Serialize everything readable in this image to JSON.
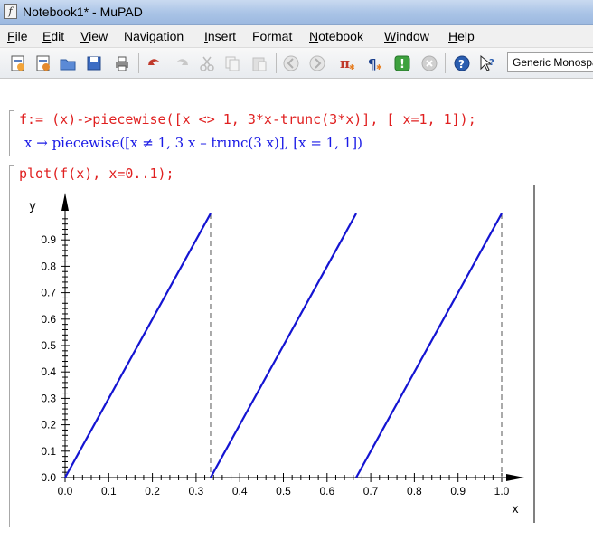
{
  "window": {
    "title": "Notebook1* - MuPAD",
    "icon": "mupad-app-icon"
  },
  "menubar": {
    "items": [
      {
        "label": "File",
        "u": "F",
        "rest": "ile"
      },
      {
        "label": "Edit",
        "u": "E",
        "rest": "dit"
      },
      {
        "label": "View",
        "u": "V",
        "rest": "iew"
      },
      {
        "label": "Navigation",
        "u": "",
        "rest": "Navigation"
      },
      {
        "label": "Insert",
        "u": "I",
        "rest": "nsert"
      },
      {
        "label": "Format",
        "u": "",
        "rest": "Format"
      },
      {
        "label": "Notebook",
        "u": "N",
        "rest": "otebook"
      },
      {
        "label": "Window",
        "u": "W",
        "rest": "indow"
      },
      {
        "label": "Help",
        "u": "H",
        "rest": "elp"
      }
    ]
  },
  "toolbar": {
    "icons": [
      "new-notebook-icon",
      "open-notebook-icon",
      "open-folder-icon",
      "save-icon",
      "print-icon",
      "undo-icon",
      "redo-icon",
      "cut-icon",
      "copy-icon",
      "paste-icon",
      "back-icon",
      "forward-icon",
      "pi-evaluate-icon",
      "formatting-icon",
      "evaluate-icon",
      "stop-icon",
      "help-icon",
      "context-help-icon"
    ],
    "font_selector": "Generic Monospace"
  },
  "notebook": {
    "input1": "f:= (x)->piecewise([x <> 1, 3*x-trunc(3*x)], [ x=1, 1]);",
    "output1": "x → piecewise([x ≠ 1, 3 x – trunc(3 x)], [x = 1, 1])",
    "input2": "plot(f(x), x=0..1);"
  },
  "chart_data": {
    "type": "line",
    "title": "",
    "xlabel": "x",
    "ylabel": "y",
    "xlim": [
      0,
      1.0
    ],
    "ylim": [
      0,
      1.0
    ],
    "xticks": [
      "0.0",
      "0.1",
      "0.2",
      "0.3",
      "0.4",
      "0.5",
      "0.6",
      "0.7",
      "0.8",
      "0.9",
      "1.0"
    ],
    "yticks": [
      "0.0",
      "0.1",
      "0.2",
      "0.3",
      "0.4",
      "0.5",
      "0.6",
      "0.7",
      "0.8",
      "0.9"
    ],
    "series": [
      {
        "segments": [
          {
            "x": [
              0,
              0.3333
            ],
            "y": [
              0,
              1
            ]
          },
          {
            "x": [
              0.3333,
              0.6667
            ],
            "y": [
              0,
              1
            ]
          },
          {
            "x": [
              0.6667,
              1.0
            ],
            "y": [
              0,
              1
            ]
          }
        ],
        "color": "#1414d2"
      }
    ],
    "discontinuities_x": [
      0.3333,
      1.0
    ],
    "grid": false
  }
}
